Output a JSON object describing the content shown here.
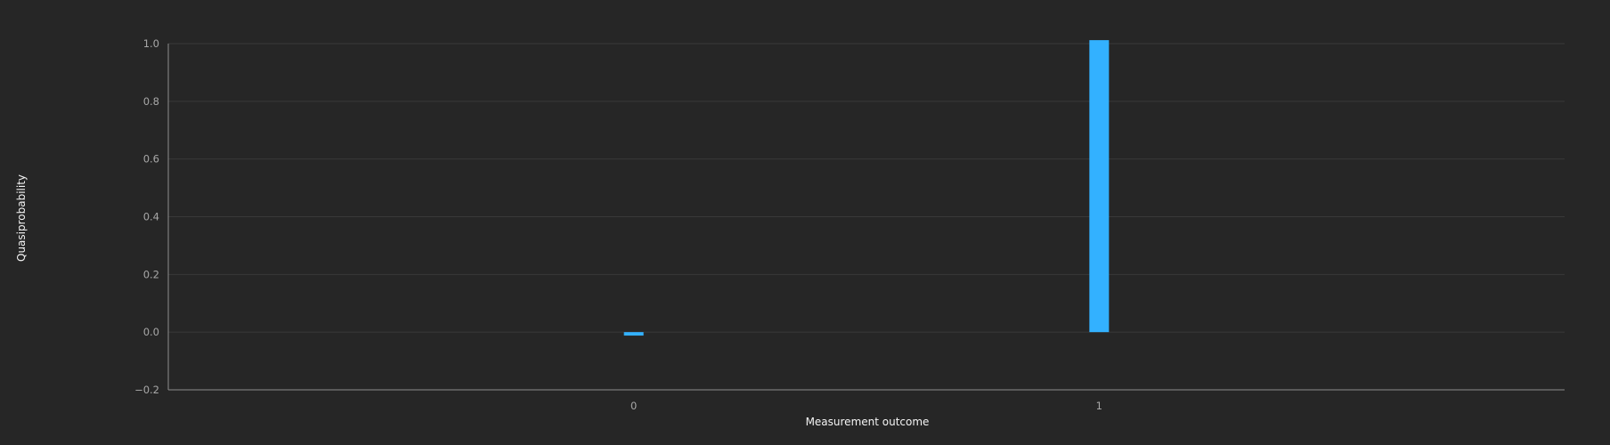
{
  "chart_data": {
    "type": "bar",
    "categories": [
      "0",
      "1"
    ],
    "values": [
      -0.012,
      1.012
    ],
    "xlabel": "Measurement outcome",
    "ylabel": "Quasiprobability",
    "ylim": [
      -0.2,
      1.0
    ],
    "yticks": [
      "−0.2",
      "0.0",
      "0.2",
      "0.4",
      "0.6",
      "0.8",
      "1.0"
    ],
    "grid": true,
    "legend": "none",
    "colors": {
      "bar": "#33b1ff",
      "background": "#262626",
      "grid": "#393939",
      "axis": "#8d8d8d",
      "tick_text": "#a8a8a8",
      "title_text": "#f4f4f4"
    }
  }
}
